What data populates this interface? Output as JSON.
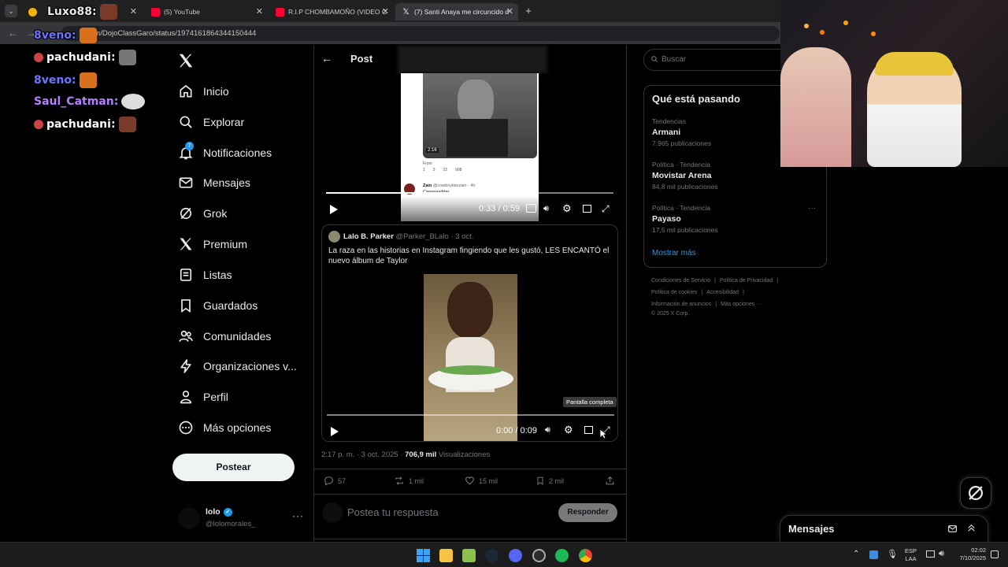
{
  "browser": {
    "tabs": [
      {
        "title": "",
        "active": false
      },
      {
        "title": "(5) YouTube",
        "active": false
      },
      {
        "title": "R.I.P CHOMBAMOÑO (VIDEO C",
        "active": false
      },
      {
        "title": "(7) Santi Anaya me circuncido d",
        "active": true
      }
    ],
    "url": "om/DojoClassGaro/status/1974161864344150444",
    "new_tab_glyph": "+"
  },
  "chat": [
    {
      "user": "Luxo88",
      "color": "#e8e8e8"
    },
    {
      "user": "8veno",
      "color": "#6f74ff"
    },
    {
      "user": "pachudani",
      "color": "#ffffff"
    },
    {
      "user": "8veno",
      "color": "#6f74ff"
    },
    {
      "user": "Saul_Catman",
      "color": "#b77cff"
    },
    {
      "user": "pachudani",
      "color": "#ffffff"
    }
  ],
  "sidebar": {
    "items": [
      {
        "label": "Inicio",
        "icon": "home-icon"
      },
      {
        "label": "Explorar",
        "icon": "search-icon"
      },
      {
        "label": "Notificaciones",
        "icon": "bell-icon",
        "badge": "7"
      },
      {
        "label": "Mensajes",
        "icon": "mail-icon"
      },
      {
        "label": "Grok",
        "icon": "grok-icon"
      },
      {
        "label": "Premium",
        "icon": "x-logo-icon"
      },
      {
        "label": "Listas",
        "icon": "list-icon"
      },
      {
        "label": "Guardados",
        "icon": "bookmark-icon"
      },
      {
        "label": "Comunidades",
        "icon": "communities-icon"
      },
      {
        "label": "Organizaciones v...",
        "icon": "lightning-icon"
      },
      {
        "label": "Perfil",
        "icon": "person-icon"
      },
      {
        "label": "Más opciones",
        "icon": "more-circle-icon"
      }
    ],
    "post_button": "Postear",
    "account": {
      "name": "lolo",
      "handle": "@lolomorales_"
    }
  },
  "post": {
    "header_title": "Post",
    "top_video": {
      "time": "0:33 / 0:59",
      "inner": {
        "duration": "2:16",
        "from": "From",
        "reply_user": "Zain",
        "reply_handle": "@cowboylikezain · 4h",
        "reply_text": "Caaaaaaddar",
        "counts": [
          "1",
          "3",
          "22",
          "908"
        ]
      }
    },
    "quoted": {
      "author": "Lalo B. Parker",
      "handle": "@Parker_BLalo",
      "date": "· 3 oct.",
      "text": "La raza en las historias en Instagram fingiendo que les gustó, LES ENCANTÓ el nuevo álbum de Taylor",
      "video_time": "0:00 / 0:09",
      "tooltip": "Pantalla completa"
    },
    "meta": {
      "time": "2:17 p. m. · 3 oct. 2025 ·",
      "views": "706,9 mil",
      "views_label": "Visualizaciones"
    },
    "actions": {
      "replies": "57",
      "reposts": "1 mil",
      "likes": "15 mil",
      "bookmarks": "2 mil"
    },
    "reply": {
      "placeholder": "Postea tu respuesta",
      "button": "Responder"
    }
  },
  "right": {
    "search_placeholder": "Buscar",
    "trends_title": "Qué está pasando",
    "trends": [
      {
        "context": "Tendencias",
        "name": "Armani",
        "count": "7.965 publicaciones"
      },
      {
        "context": "Política · Tendencia",
        "name": "Movistar Arena",
        "count": "84,8 mil publicaciones"
      },
      {
        "context": "Política · Tendencia",
        "name": "Payaso",
        "count": "17,5 mil publicaciones"
      }
    ],
    "show_more": "Mostrar más",
    "footer": [
      "Condiciones de Servicio",
      "Política de Privacidad",
      "Política de cookies",
      "Accesibilidad",
      "Información de anuncios",
      "Más opciones ···",
      "© 2025 X Corp."
    ]
  },
  "messages_drawer": {
    "title": "Mensajes"
  },
  "taskbar": {
    "lang": "ESP",
    "lang2": "LAA",
    "time": "02:02",
    "date": "7/10/2025"
  },
  "colors": {
    "accent": "#1d9bf0",
    "bg": "#000000",
    "border": "#2f3336",
    "muted": "#71767b"
  }
}
